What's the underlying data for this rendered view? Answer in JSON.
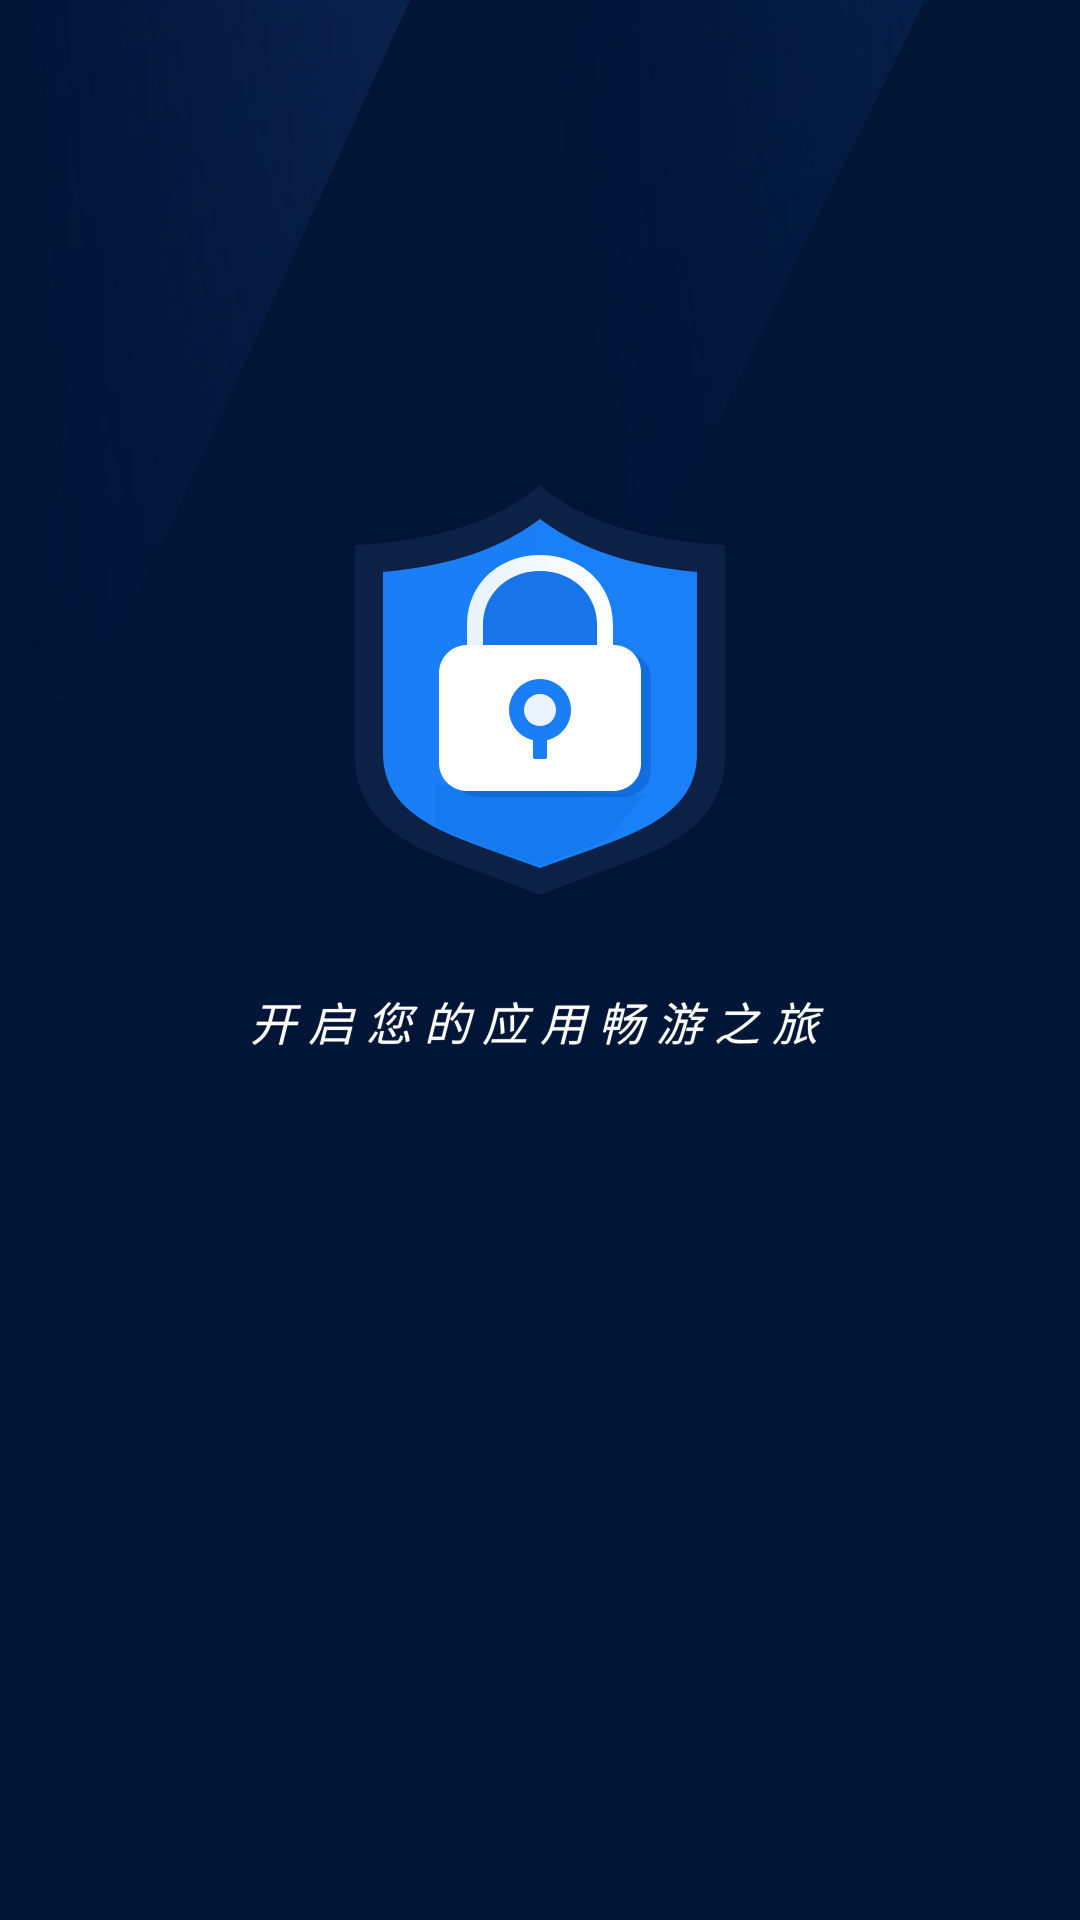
{
  "splash": {
    "slogan": "开启您的应用畅游之旅",
    "logo_icon": "shield-lock-icon"
  },
  "colors": {
    "background": "#011536",
    "shield_outer": "#0d2147",
    "shield_blue": "#1a7ff7",
    "lock_white": "#ffffff"
  }
}
